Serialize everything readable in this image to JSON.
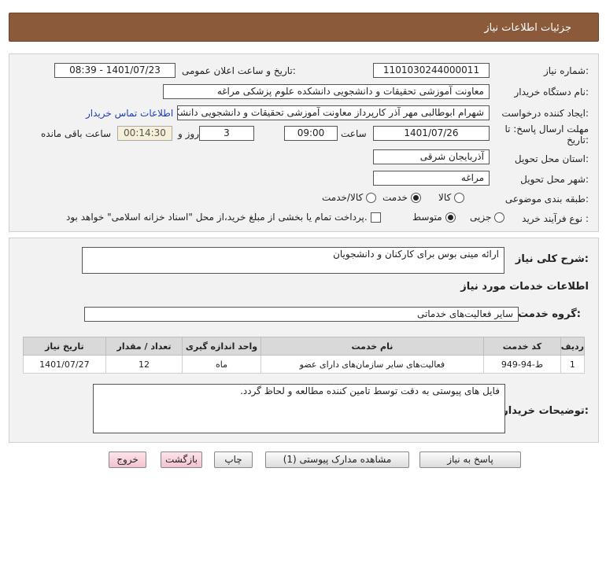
{
  "header": {
    "title": "جزئیات اطلاعات نیاز"
  },
  "form": {
    "need_number_label": "شماره نیاز:",
    "need_number": "1101030244000011",
    "announce_label": "تاریخ و ساعت اعلان عمومی:",
    "announce_value": "1401/07/23 - 08:39",
    "buyer_org_label": "نام دستگاه خریدار:",
    "buyer_org": "معاونت آموزشی تحقیقات و دانشجویی دانشکده علوم پزشکی مراغه",
    "creator_label": "ایجاد کننده درخواست:",
    "creator": "شهرام ابوطالبی مهر آذر کارپرداز معاونت آموزشی تحقیقات و دانشجویی دانشکده",
    "contact_link": "اطلاعات تماس خریدار",
    "deadline_label": "مهلت ارسال پاسخ: تا",
    "deadline_label2": "تاریخ:",
    "deadline_date": "1401/07/26",
    "time_label": "ساعت",
    "deadline_time": "09:00",
    "days_value": "3",
    "days_label": "روز و",
    "remaining_time": "00:14:30",
    "remaining_label": "ساعت باقی مانده",
    "province_label": "استان محل تحویل:",
    "province": "آذربایجان شرقی",
    "city_label": "شهر محل تحویل:",
    "city": "مراغه",
    "category_label": "طبقه بندی موضوعی:",
    "category_options": [
      "کالا",
      "خدمت",
      "کالا/خدمت"
    ],
    "category_selected": "خدمت",
    "process_label": "نوع فرآیند خرید :",
    "process_options": [
      "جزیی",
      "متوسط"
    ],
    "process_selected": "متوسط",
    "payment_note": "پرداخت تمام یا بخشی از مبلغ خرید،از محل \"اسناد خزانه اسلامی\" خواهد بود."
  },
  "details": {
    "general_desc_label": "شرح کلی نیاز:",
    "general_desc": "ارائه مینی بوس برای کارکنان و دانشجویان",
    "services_title": "اطلاعات خدمات مورد نیاز",
    "service_group_label": "گروه خدمت:",
    "service_group": "سایر فعالیت‌های خدماتی",
    "table": {
      "headers": [
        "ردیف",
        "کد خدمت",
        "نام خدمت",
        "واحد اندازه گیری",
        "تعداد / مقدار",
        "تاریخ نیاز"
      ],
      "rows": [
        [
          "1",
          "ط-94-949",
          "فعالیت‌های سایر سازمان‌های دارای عضو",
          "ماه",
          "12",
          "1401/07/27"
        ]
      ]
    },
    "buyer_notes_label": "توضیحات خریدار:",
    "buyer_notes": "فایل های پیوستی به دقت توسط تامین کننده مطالعه و لحاظ گردد."
  },
  "buttons": {
    "reply": "پاسخ به نیاز",
    "attachments": "مشاهده مدارک پیوستی (1)",
    "print": "چاپ",
    "back": "بازگشت",
    "exit": "خروج"
  }
}
